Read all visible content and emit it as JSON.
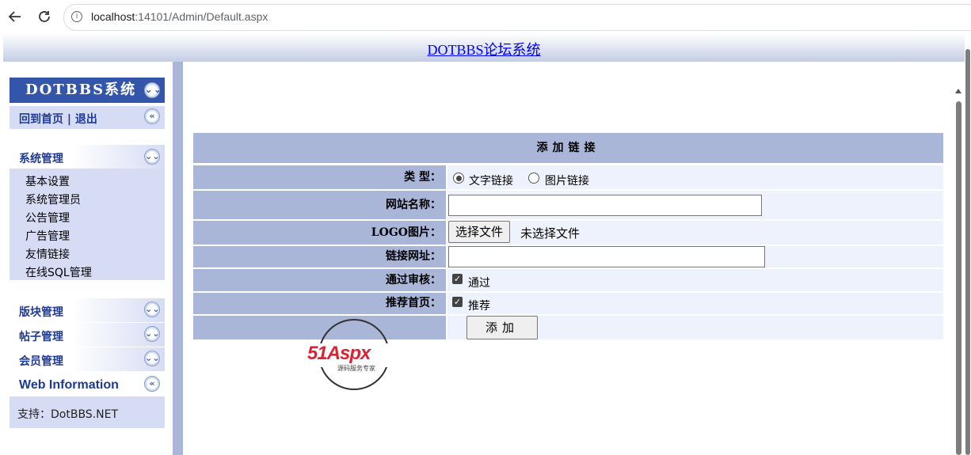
{
  "browser": {
    "url_host": "localhost",
    "url_rest": ":14101/Admin/Default.aspx"
  },
  "header": {
    "title": "DOTBBS论坛系统"
  },
  "sidebar": {
    "title": "DOTBBS系统",
    "home_logout": "回到首页 | 退出",
    "sections": [
      {
        "label": "系统管理",
        "items": [
          "基本设置",
          "系统管理员",
          "公告管理",
          "广告管理",
          "友情链接",
          "在线SQL管理"
        ]
      },
      {
        "label": "版块管理"
      },
      {
        "label": "帖子管理"
      },
      {
        "label": "会员管理"
      },
      {
        "label": "Web Information"
      }
    ],
    "support": "支持：DotBBS.NET"
  },
  "form": {
    "heading": "添加链接",
    "type_label": "类        型：",
    "type_options": [
      "文字链接",
      "图片链接"
    ],
    "type_selected": "文字链接",
    "site_name_label": "网站名称：",
    "site_name_value": "",
    "logo_label": "LOGO图片：",
    "file_button": "选择文件",
    "file_status": "未选择文件",
    "url_label": "链接网址：",
    "url_value": "",
    "approve_label": "通过审核：",
    "approve_text": "通过",
    "approve_checked": true,
    "recommend_label": "推荐首页：",
    "recommend_text": "推荐",
    "recommend_checked": true,
    "submit": "添加"
  },
  "watermark": {
    "brand": "51Aspx",
    "tagline": "源码服务专家"
  }
}
